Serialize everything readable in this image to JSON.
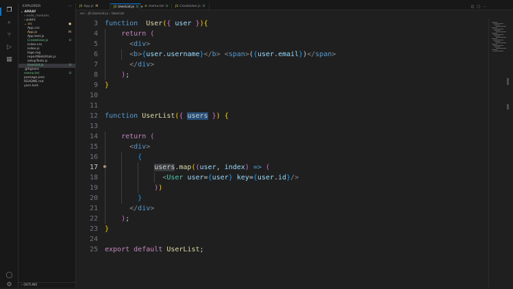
{
  "explorer": {
    "title": "EXPLORER",
    "more": "···",
    "root": "ARRAY",
    "items": [
      {
        "label": "node_modules",
        "depth": 1,
        "arrow": "›",
        "badge": "",
        "cls": "g"
      },
      {
        "label": "public",
        "depth": 1,
        "arrow": "›",
        "badge": "",
        "cls": ""
      },
      {
        "label": "src",
        "depth": 1,
        "arrow": "⌄",
        "badge": "●",
        "cls": "m"
      },
      {
        "label": "App.css",
        "depth": 2,
        "arrow": "",
        "badge": "",
        "cls": ""
      },
      {
        "label": "App.js",
        "depth": 2,
        "arrow": "",
        "badge": "M",
        "cls": "m"
      },
      {
        "label": "App.test.js",
        "depth": 2,
        "arrow": "",
        "badge": "",
        "cls": ""
      },
      {
        "label": "CreateUser.js",
        "depth": 2,
        "arrow": "",
        "badge": "U",
        "cls": "u"
      },
      {
        "label": "index.css",
        "depth": 2,
        "arrow": "",
        "badge": "",
        "cls": ""
      },
      {
        "label": "index.js",
        "depth": 2,
        "arrow": "",
        "badge": "",
        "cls": ""
      },
      {
        "label": "logo.svg",
        "depth": 2,
        "arrow": "",
        "badge": "",
        "cls": ""
      },
      {
        "label": "reportWebVitals.js",
        "depth": 2,
        "arrow": "",
        "badge": "",
        "cls": ""
      },
      {
        "label": "setupTests.js",
        "depth": 2,
        "arrow": "",
        "badge": "",
        "cls": ""
      },
      {
        "label": "UserList.js",
        "depth": 2,
        "arrow": "",
        "badge": "U",
        "cls": "u",
        "selected": true
      },
      {
        "label": ".gitignore",
        "depth": 1,
        "arrow": "",
        "badge": "",
        "cls": ""
      },
      {
        "label": "memo.txt",
        "depth": 1,
        "arrow": "",
        "badge": "U",
        "cls": "u"
      },
      {
        "label": "package.json",
        "depth": 1,
        "arrow": "",
        "badge": "",
        "cls": ""
      },
      {
        "label": "README.md",
        "depth": 1,
        "arrow": "",
        "badge": "",
        "cls": ""
      },
      {
        "label": "yarn.lock",
        "depth": 1,
        "arrow": "",
        "badge": "",
        "cls": ""
      }
    ],
    "outline": "OUTLINE"
  },
  "tabs": [
    {
      "icon": "JS",
      "label": "App.js",
      "status": "M",
      "active": false
    },
    {
      "icon": "JS",
      "label": "UserList.js",
      "status": "U",
      "active": true,
      "close": "×"
    },
    {
      "icon": "≡",
      "label": "memo.txt",
      "status": "U",
      "active": false
    },
    {
      "icon": "JS",
      "label": "CreateUser.js",
      "status": "U",
      "active": false
    }
  ],
  "breadcrumb": {
    "parts": [
      "src",
      "JS UserList.js",
      "UserList"
    ],
    "sep": " › "
  },
  "current_line": 17,
  "lines": [
    {
      "n": 3,
      "tokens": [
        [
          "kw",
          "function"
        ],
        [
          "",
          "  "
        ],
        [
          "fn",
          "User"
        ],
        [
          "b1",
          "("
        ],
        [
          "b2",
          "{"
        ],
        [
          "",
          " "
        ],
        [
          "vr",
          "user"
        ],
        [
          "",
          " "
        ],
        [
          "b2",
          "}"
        ],
        [
          "b1",
          ")"
        ],
        [
          "b1",
          "{"
        ]
      ]
    },
    {
      "n": 4,
      "tokens": [
        [
          "",
          "    "
        ],
        [
          "kwc",
          "return"
        ],
        [
          "",
          " "
        ],
        [
          "b2",
          "("
        ]
      ]
    },
    {
      "n": 5,
      "tokens": [
        [
          "",
          "      "
        ],
        [
          "g",
          "<"
        ],
        [
          "tg",
          "div"
        ],
        [
          "g",
          ">"
        ]
      ]
    },
    {
      "n": 6,
      "tokens": [
        [
          "",
          "      "
        ],
        [
          "g",
          "<"
        ],
        [
          "tg",
          "b"
        ],
        [
          "g",
          ">"
        ],
        [
          "b3",
          "{"
        ],
        [
          "vr",
          "user"
        ],
        [
          "",
          "."
        ],
        [
          "vr",
          "username"
        ],
        [
          "b3",
          "}"
        ],
        [
          "g",
          "</"
        ],
        [
          "tg",
          "b"
        ],
        [
          "g",
          ">"
        ],
        [
          "",
          " "
        ],
        [
          "g",
          "<"
        ],
        [
          "tg",
          "span"
        ],
        [
          "g",
          ">"
        ],
        [
          "",
          "("
        ],
        [
          "b3",
          "{"
        ],
        [
          "vr",
          "user"
        ],
        [
          "",
          "."
        ],
        [
          "vr",
          "email"
        ],
        [
          "b3",
          "}"
        ],
        [
          "",
          ")"
        ],
        [
          "g",
          "</"
        ],
        [
          "tg",
          "span"
        ],
        [
          "g",
          ">"
        ]
      ]
    },
    {
      "n": 7,
      "tokens": [
        [
          "",
          "      "
        ],
        [
          "g",
          "</"
        ],
        [
          "tg",
          "div"
        ],
        [
          "g",
          ">"
        ]
      ]
    },
    {
      "n": 8,
      "tokens": [
        [
          "",
          "    "
        ],
        [
          "b2",
          ")"
        ],
        [
          "",
          ";"
        ]
      ]
    },
    {
      "n": 9,
      "tokens": [
        [
          "b1",
          "}"
        ]
      ]
    },
    {
      "n": 10,
      "tokens": []
    },
    {
      "n": 11,
      "tokens": []
    },
    {
      "n": 12,
      "tokens": [
        [
          "kw",
          "function"
        ],
        [
          "",
          " "
        ],
        [
          "fn",
          "UserList"
        ],
        [
          "b1",
          "("
        ],
        [
          "b2",
          "{"
        ],
        [
          "",
          " "
        ],
        [
          "hl",
          "users"
        ],
        [
          "",
          " "
        ],
        [
          "b2",
          "}"
        ],
        [
          "b1",
          ")"
        ],
        [
          "",
          " "
        ],
        [
          "b1",
          "{"
        ]
      ]
    },
    {
      "n": 13,
      "tokens": []
    },
    {
      "n": 14,
      "tokens": [
        [
          "",
          "    "
        ],
        [
          "kwc",
          "return"
        ],
        [
          "",
          " "
        ],
        [
          "b2",
          "("
        ]
      ]
    },
    {
      "n": 15,
      "tokens": [
        [
          "",
          "      "
        ],
        [
          "g",
          "<"
        ],
        [
          "tg",
          "div"
        ],
        [
          "g",
          ">"
        ]
      ]
    },
    {
      "n": 16,
      "tokens": [
        [
          "",
          "        "
        ],
        [
          "b3",
          "{"
        ]
      ]
    },
    {
      "n": 17,
      "tokens": [
        [
          "",
          "            "
        ],
        [
          "hl2",
          "users"
        ],
        [
          "",
          "."
        ],
        [
          "fn",
          "map"
        ],
        [
          "b1",
          "("
        ],
        [
          "b2",
          "("
        ],
        [
          "vr",
          "user"
        ],
        [
          "",
          ", "
        ],
        [
          "vr",
          "index"
        ],
        [
          "b2",
          ")"
        ],
        [
          "",
          " "
        ],
        [
          "kw",
          "=>"
        ],
        [
          "",
          " "
        ],
        [
          "b2",
          "("
        ]
      ]
    },
    {
      "n": 18,
      "tokens": [
        [
          "",
          "              "
        ],
        [
          "g",
          "<"
        ],
        [
          "cmp",
          "User"
        ],
        [
          "",
          " "
        ],
        [
          "vr",
          "user"
        ],
        [
          "",
          "="
        ],
        [
          "b3",
          "{"
        ],
        [
          "vr",
          "user"
        ],
        [
          "b3",
          "}"
        ],
        [
          "",
          " "
        ],
        [
          "vr",
          "key"
        ],
        [
          "",
          "="
        ],
        [
          "b3",
          "{"
        ],
        [
          "vr",
          "user"
        ],
        [
          "",
          "."
        ],
        [
          "vr",
          "id"
        ],
        [
          "b3",
          "}"
        ],
        [
          "g",
          "/>"
        ]
      ]
    },
    {
      "n": 19,
      "tokens": [
        [
          "",
          "            "
        ],
        [
          "b2",
          ")"
        ],
        [
          "b1",
          ")"
        ]
      ]
    },
    {
      "n": 20,
      "tokens": [
        [
          "",
          "        "
        ],
        [
          "b3",
          "}"
        ]
      ]
    },
    {
      "n": 21,
      "tokens": [
        [
          "",
          "      "
        ],
        [
          "g",
          "</"
        ],
        [
          "tg",
          "div"
        ],
        [
          "g",
          ">"
        ]
      ]
    },
    {
      "n": 22,
      "tokens": [
        [
          "",
          "    "
        ],
        [
          "b2",
          ")"
        ],
        [
          "",
          ";"
        ]
      ]
    },
    {
      "n": 23,
      "tokens": [
        [
          "b1",
          "}"
        ]
      ]
    },
    {
      "n": 24,
      "tokens": []
    },
    {
      "n": 25,
      "tokens": [
        [
          "kwc",
          "export"
        ],
        [
          "",
          " "
        ],
        [
          "kwc",
          "default"
        ],
        [
          "",
          " "
        ],
        [
          "fn",
          "UserList"
        ],
        [
          "",
          ";"
        ]
      ]
    }
  ]
}
